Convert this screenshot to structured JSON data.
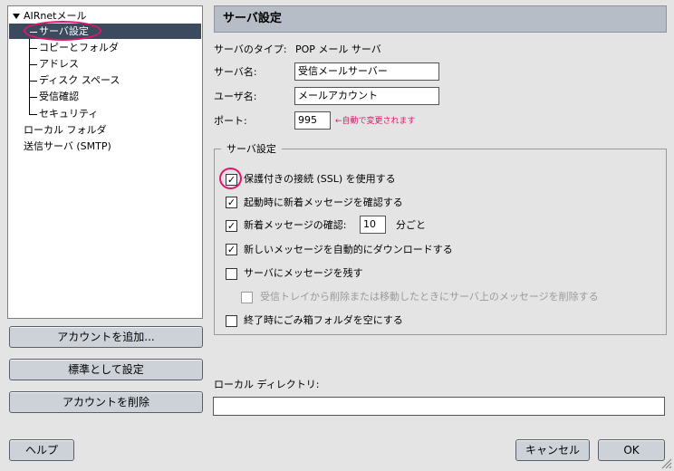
{
  "tree": {
    "root": "AIRnetメール",
    "items": [
      "サーバ設定",
      "コピーとフォルダ",
      "アドレス",
      "ディスク スペース",
      "受信確認",
      "セキュリティ"
    ],
    "local": "ローカル フォルダ",
    "smtp": "送信サーバ (SMTP)"
  },
  "left_buttons": {
    "add": "アカウントを追加...",
    "default": "標準として設定",
    "delete": "アカウントを削除"
  },
  "panel": {
    "title": "サーバ設定",
    "server_type_label": "サーバのタイプ:",
    "server_type_value": "POP メール サーバ",
    "server_name_label": "サーバ名:",
    "server_name_value": "受信メールサーバー",
    "user_name_label": "ユーザ名:",
    "user_name_value": "メールアカウント",
    "port_label": "ポート:",
    "port_value": "995",
    "port_note": "←自動で変更されます"
  },
  "group": {
    "title": "サーバ設定",
    "ssl": "保護付きの接続 (SSL) を使用する",
    "check_startup": "起動時に新着メッセージを確認する",
    "check_every": "新着メッセージの確認:",
    "check_minutes": "10",
    "minutes_unit": "分ごと",
    "auto_download": "新しいメッセージを自動的にダウンロードする",
    "leave_on_server": "サーバにメッセージを残す",
    "delete_from_server": "受信トレイから削除または移動したときにサーバ上のメッセージを削除する",
    "empty_trash": "終了時にごみ箱フォルダを空にする",
    "checked": [
      true,
      true,
      true,
      true,
      false,
      false,
      false
    ]
  },
  "local_dir": {
    "label": "ローカル ディレクトリ:",
    "value": ""
  },
  "footer": {
    "help": "ヘルプ",
    "cancel": "キャンセル",
    "ok": "OK"
  },
  "colors": {
    "selection": "#3c4a5e",
    "highlight": "#e0166a",
    "header": "#b7bdc6"
  }
}
